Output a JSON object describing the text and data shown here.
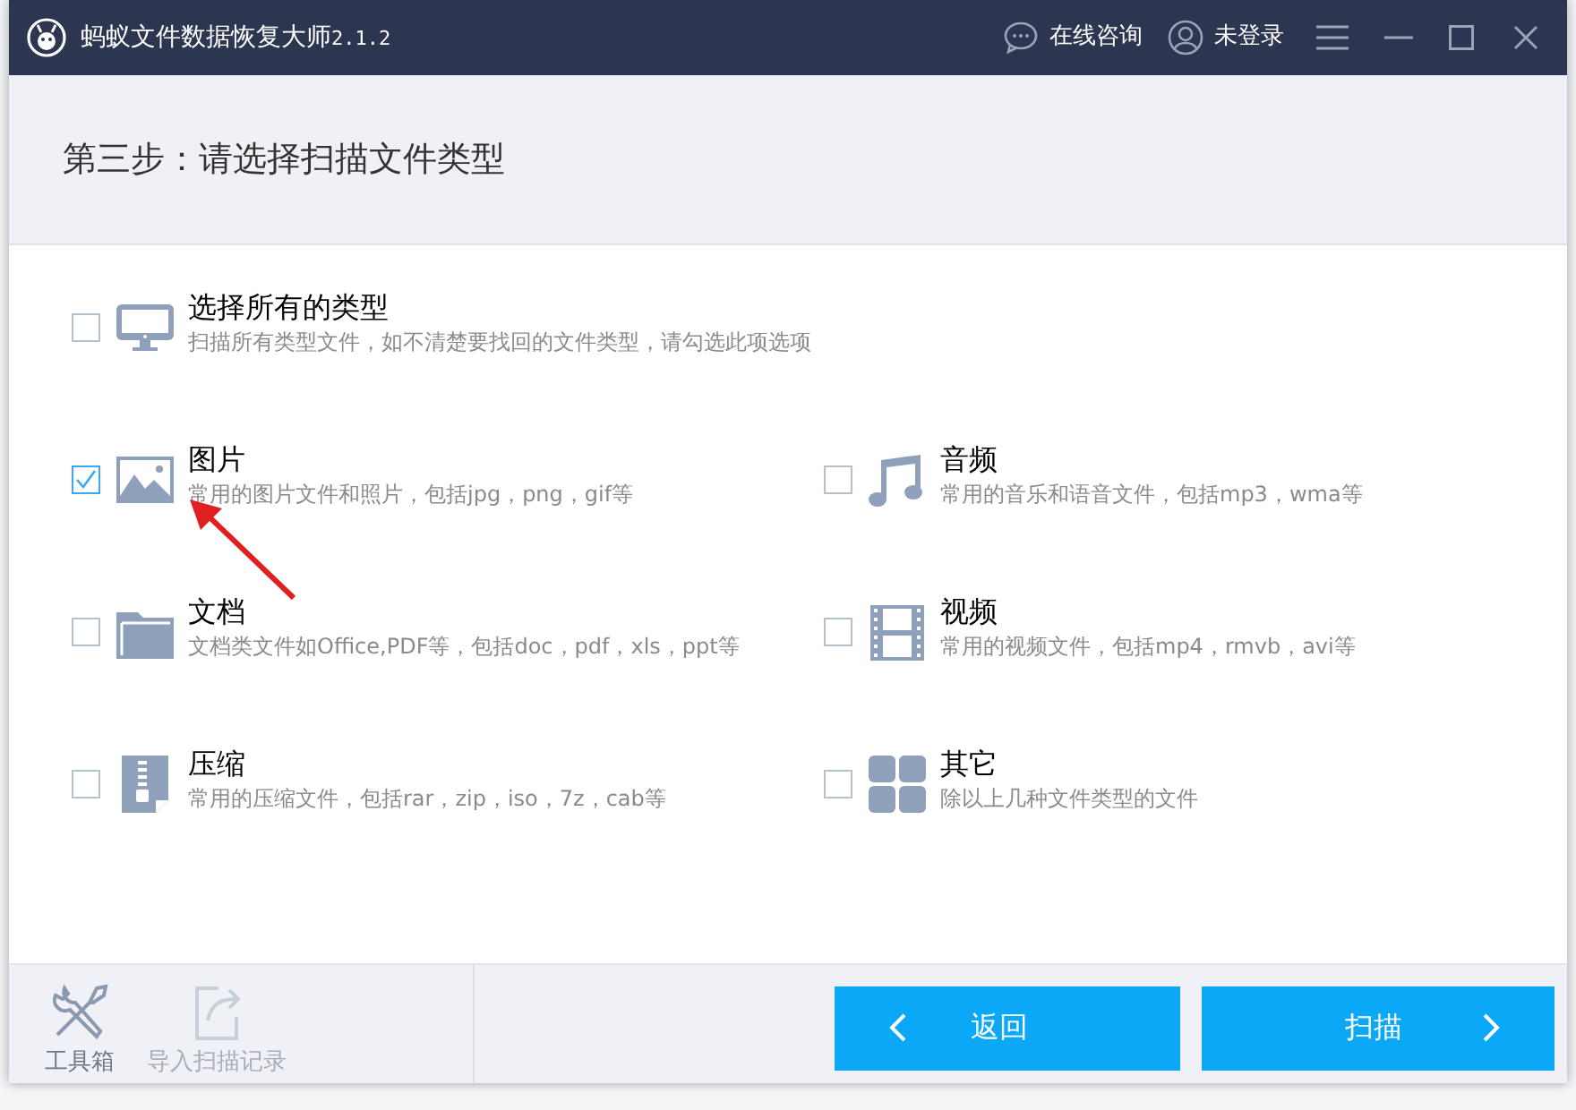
{
  "window": {
    "title": "蚂蚁文件数据恢复大师",
    "version": "2.1.2",
    "actions": [
      {
        "label": "在线咨询"
      },
      {
        "label": "未登录"
      }
    ]
  },
  "step_title": "第三步：请选择扫描文件类型",
  "select_all": {
    "label": "选择所有的类型",
    "description": "扫描所有类型文件，如不清楚要找回的文件类型，请勾选此项选项",
    "checked": false
  },
  "types": [
    {
      "label": "图片",
      "description": "常用的图片文件和照片，包括jpg，png，gif等",
      "checked": true
    },
    {
      "label": "音频",
      "description": "常用的音乐和语音文件，包括mp3，wma等",
      "checked": false
    },
    {
      "label": "文档",
      "description": "文档类文件如Office,PDF等，包括doc，pdf，xls，ppt等",
      "checked": false
    },
    {
      "label": "视频",
      "description": "常用的视频文件，包括mp4，rmvb，avi等",
      "checked": false
    },
    {
      "label": "压缩",
      "description": "常用的压缩文件，包括rar，zip，iso，7z，cab等",
      "checked": false
    },
    {
      "label": "其它",
      "description": "除以上几种文件类型的文件",
      "checked": false
    }
  ],
  "tools": [
    {
      "label": "工具箱",
      "disabled": false
    },
    {
      "label": "导入扫描记录",
      "disabled": true
    }
  ],
  "buttons": [
    {
      "label": "返回",
      "kind": "back"
    },
    {
      "label": "扫描",
      "kind": "next"
    }
  ]
}
